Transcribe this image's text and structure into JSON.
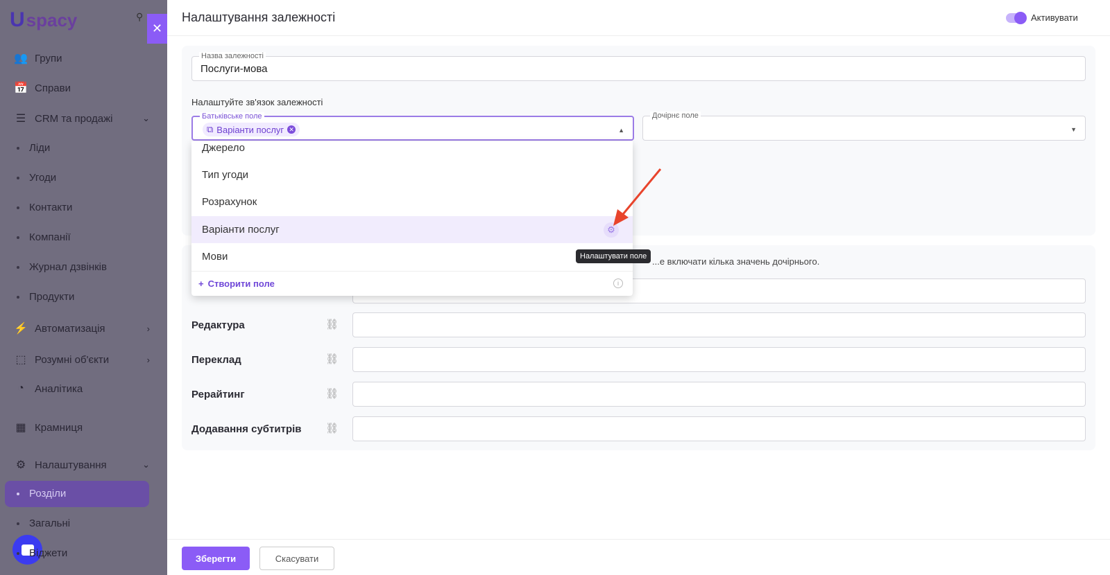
{
  "sidebar": {
    "logo": "spacy",
    "logo_mark": "U",
    "items": [
      {
        "label": "Групи",
        "icon": "users-icon"
      },
      {
        "label": "Справи",
        "icon": "calendar-icon"
      },
      {
        "label": "CRM та продажі",
        "icon": "database-icon"
      },
      {
        "label": "Ліди"
      },
      {
        "label": "Угоди"
      },
      {
        "label": "Контакти"
      },
      {
        "label": "Компанії"
      },
      {
        "label": "Журнал дзвінків"
      },
      {
        "label": "Продукти"
      },
      {
        "label": "Автоматизація",
        "icon": "lightning-icon"
      },
      {
        "label": "Розумні об'єкти",
        "icon": "smart-object-icon"
      },
      {
        "label": "Аналітика",
        "icon": "chart-icon"
      },
      {
        "label": "Крамниця",
        "icon": "store-icon"
      },
      {
        "label": "Налаштування",
        "icon": "gear-icon"
      },
      {
        "label": "Розділи"
      },
      {
        "label": "Загальні"
      },
      {
        "label": "Віджети"
      }
    ]
  },
  "panel": {
    "title": "Налаштування залежності",
    "toggle_label": "Активувати",
    "toggle_on": true,
    "name_label": "Назва залежності",
    "name_value": "Послуги-мова",
    "section_label": "Налаштуйте зв'язок залежності",
    "parent_label": "Батьківське поле",
    "parent_chip": "Варіанти послуг",
    "child_label": "Дочірнє поле",
    "options": [
      "Джерело",
      "Тип угоди",
      "Розрахунок",
      "Варіанти послуг",
      "Мови"
    ],
    "create_label": "Створити поле",
    "tooltip": "Налаштувати поле",
    "hint": "...е включати кілька значень дочірнього.",
    "rows": [
      "Редактура",
      "Переклад",
      "Рерайтинг",
      "Додавання субтитрів"
    ],
    "save": "Зберегти",
    "cancel": "Скасувати"
  },
  "colors": {
    "accent": "#8b5cf6",
    "annotation_arrow": "#e8442c"
  }
}
